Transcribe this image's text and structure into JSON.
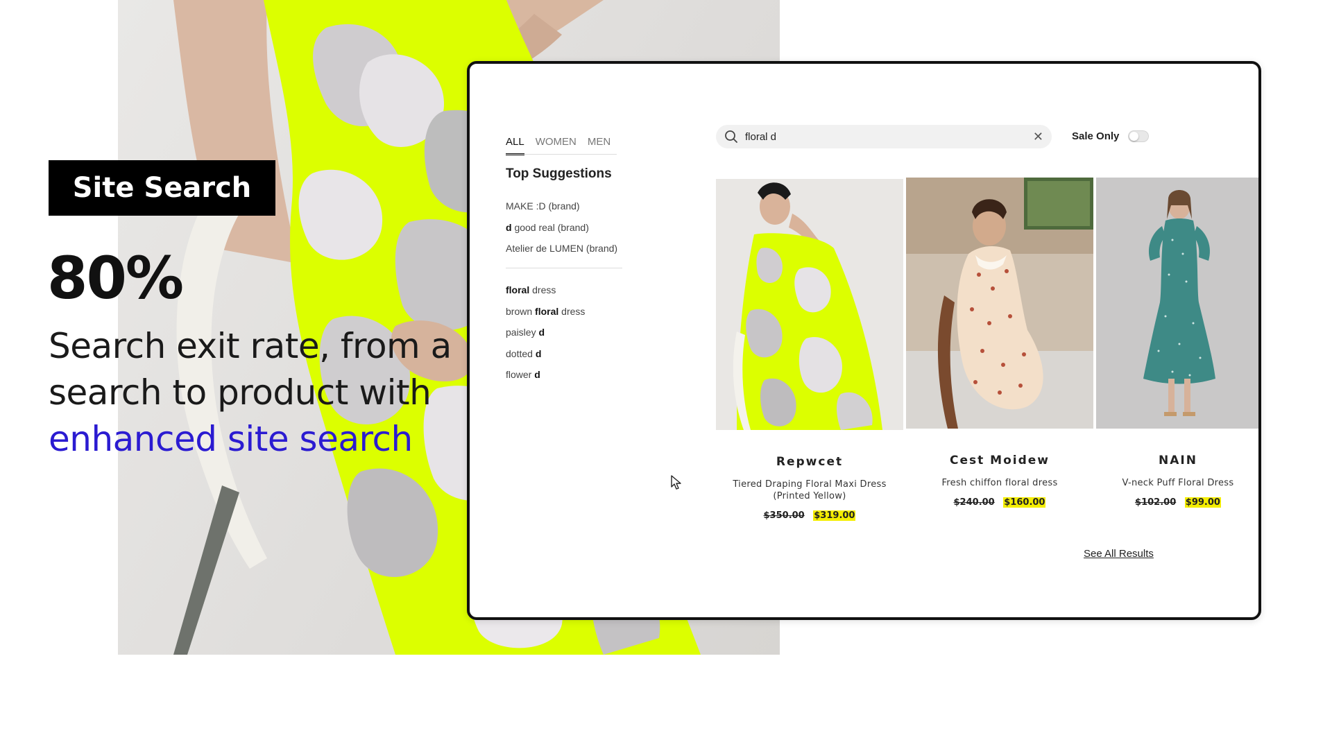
{
  "hero": {
    "badge": "Site Search",
    "stat": "80%",
    "description": "Search exit rate, from a search to product with",
    "description_accent": "enhanced site search",
    "accent_color": "#2b1bd1"
  },
  "search_ui": {
    "tabs": [
      {
        "label": "ALL",
        "active": true
      },
      {
        "label": "WOMEN",
        "active": false
      },
      {
        "label": "MEN",
        "active": false
      }
    ],
    "suggestions_title": "Top Suggestions",
    "brand_suggestions": [
      {
        "prefix": "",
        "bold": "",
        "rest": "MAKE :D (brand)"
      },
      {
        "prefix": "",
        "bold": "d",
        "rest": " good real (brand)"
      },
      {
        "prefix": "",
        "bold": "",
        "rest": "Atelier de LUMEN (brand)"
      }
    ],
    "term_suggestions": [
      {
        "bold": "floral",
        "rest": " dress",
        "bold_first": true
      },
      {
        "pre": "brown ",
        "bold": "floral",
        "rest": " dress"
      },
      {
        "pre": "paisley ",
        "bold": "d",
        "rest": ""
      },
      {
        "pre": "dotted ",
        "bold": "d",
        "rest": ""
      },
      {
        "pre": "flower ",
        "bold": "d",
        "rest": ""
      }
    ],
    "search": {
      "value": "floral d",
      "clear_icon": "close-icon"
    },
    "sale_only_label": "Sale Only",
    "sale_only_on": false,
    "products": [
      {
        "brand": "Repwcet",
        "name_line1": "Tiered Draping Floral Maxi Dress",
        "name_line2": "(Printed Yellow)",
        "old_price": "$350.00",
        "new_price": "$319.00"
      },
      {
        "brand": "Cest Moidew",
        "name_line1": "Fresh chiffon floral dress",
        "name_line2": "",
        "old_price": "$240.00",
        "new_price": "$160.00"
      },
      {
        "brand": "NAIN",
        "name_line1": "V-neck Puff Floral Dress",
        "name_line2": "",
        "old_price": "$102.00",
        "new_price": "$99.00"
      }
    ],
    "see_all_label": "See All Results",
    "sale_highlight_color": "#f4ee00"
  }
}
